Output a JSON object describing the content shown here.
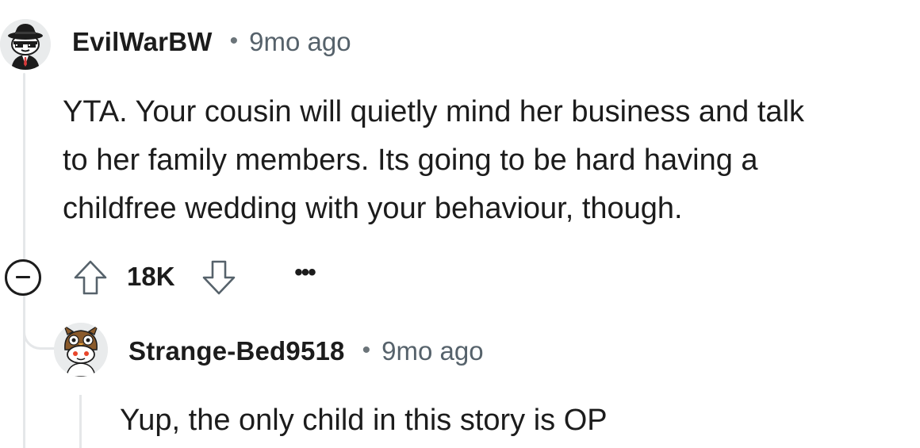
{
  "comment": {
    "username": "EvilWarBW",
    "separator": "•",
    "timestamp": "9mo ago",
    "body_lines": [
      "YTA. Your cousin will quietly mind her business and talk",
      "to her family members. Its going to be hard having a",
      "childfree wedding with your behaviour, though."
    ],
    "score": "18K",
    "more_label": "•••",
    "avatar_icon": "snoo-sunglasses-fedora-avatar"
  },
  "reply": {
    "username": "Strange-Bed9518",
    "separator": "•",
    "timestamp": "9mo ago",
    "body": "Yup, the only child in this story is OP",
    "avatar_icon": "snoo-owl-hat-avatar"
  },
  "icons": {
    "collapse": "collapse-minus-icon",
    "upvote": "upvote-arrow-icon",
    "downvote": "downvote-arrow-icon"
  },
  "colors": {
    "text": "#1c1c1c",
    "meta": "#56626b",
    "thread_line": "#e5e7e9",
    "avatar_bg": "#e9ebec"
  }
}
